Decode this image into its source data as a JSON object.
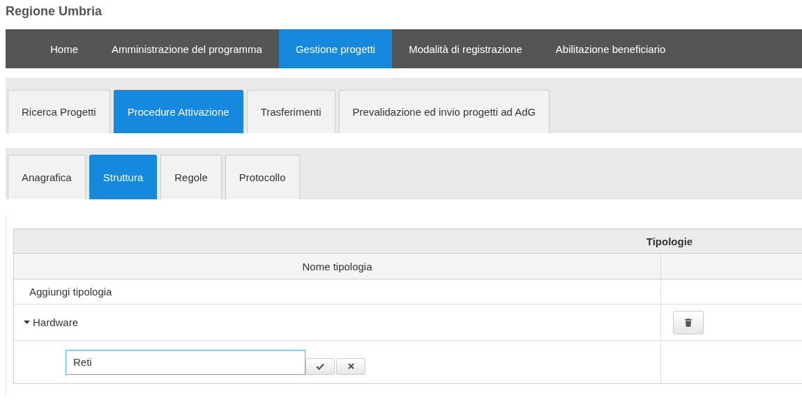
{
  "header": {
    "title": "Regione Umbria"
  },
  "nav": [
    {
      "label": "Home",
      "selected": false
    },
    {
      "label": "Amministrazione del programma",
      "selected": false
    },
    {
      "label": "Gestione progetti",
      "selected": true
    },
    {
      "label": "Modalità di registrazione",
      "selected": false
    },
    {
      "label": "Abilitazione beneficiario",
      "selected": false
    }
  ],
  "tabs": [
    {
      "label": "Ricerca Progetti",
      "selected": false
    },
    {
      "label": "Procedure Attivazione",
      "selected": true
    },
    {
      "label": "Trasferimenti",
      "selected": false
    },
    {
      "label": "Prevalidazione ed invio progetti ad AdG",
      "selected": false
    }
  ],
  "subtabs": [
    {
      "label": "Anagrafica",
      "selected": false
    },
    {
      "label": "Struttura",
      "selected": true
    },
    {
      "label": "Regole",
      "selected": false
    },
    {
      "label": "Protocollo",
      "selected": false
    }
  ],
  "table": {
    "title": "Tipologie",
    "columns": [
      "Nome tipologia"
    ],
    "rows": [
      {
        "kind": "add",
        "label": "Aggiungi tipologia"
      },
      {
        "kind": "node",
        "label": "Hardware",
        "expanded": true,
        "children": [
          {
            "kind": "edit",
            "value": "Reti"
          }
        ]
      }
    ]
  }
}
